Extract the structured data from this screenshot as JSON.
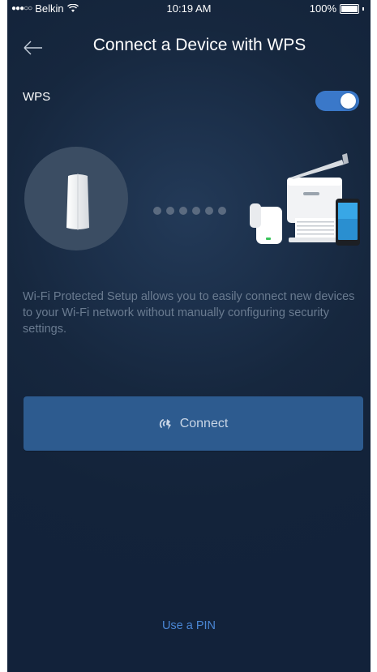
{
  "status_bar": {
    "signal_dots": "●●●○○",
    "carrier": "Belkin",
    "time": "10:19 AM",
    "battery": "100%"
  },
  "header": {
    "title": "Connect a Device with WPS"
  },
  "wps": {
    "label": "WPS",
    "enabled": true
  },
  "illustration": {
    "dot_count": 6
  },
  "description": "Wi-Fi Protected Setup allows you to easily connect new devices to your Wi-Fi network without manually configuring security settings.",
  "connect_button": {
    "label": "Connect",
    "icon": "wps-icon"
  },
  "pin_link": "Use a PIN",
  "colors": {
    "background": "#13233a",
    "accent": "#3a78c9",
    "button": "#2d5b8f",
    "link": "#4a86d4"
  }
}
